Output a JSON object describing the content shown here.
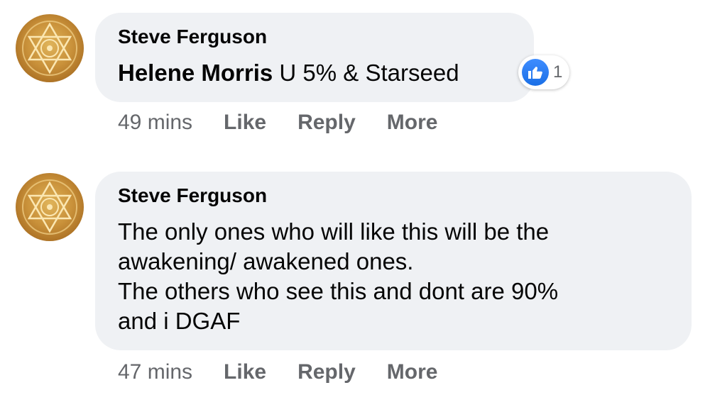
{
  "comments": [
    {
      "author": "Steve Ferguson",
      "mention": "Helene Morris",
      "text": " U 5% & Starseed",
      "reaction_count": "1",
      "time": "49 mins",
      "like_label": "Like",
      "reply_label": "Reply",
      "more_label": "More"
    },
    {
      "author": "Steve Ferguson",
      "lines": [
        "The only ones who will like this will be the",
        "awakening/ awakened ones.",
        "The others who see this and dont are 90%",
        "and i DGAF"
      ],
      "time": "47 mins",
      "like_label": "Like",
      "reply_label": "Reply",
      "more_label": "More"
    }
  ],
  "colors": {
    "bubble": "#eff1f4",
    "meta_text": "#65676b",
    "like_blue": "#1a6fe6"
  }
}
